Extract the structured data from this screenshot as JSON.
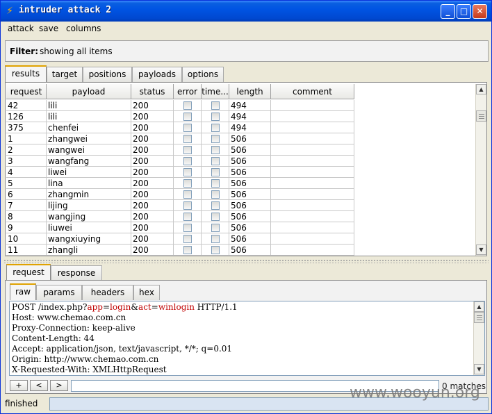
{
  "window": {
    "title": "intruder attack 2",
    "icon": "lightning-icon",
    "controls": {
      "minimize": "_",
      "maximize": "□",
      "close": "✕"
    }
  },
  "menu": [
    "attack",
    "save",
    "columns"
  ],
  "filter": {
    "label": "Filter:",
    "value": "showing all items"
  },
  "main_tabs": [
    "results",
    "target",
    "positions",
    "payloads",
    "options"
  ],
  "main_tab_active": "results",
  "table": {
    "columns": [
      "request",
      "payload",
      "status",
      "error",
      "time...",
      "length",
      "comment"
    ],
    "rows": [
      {
        "request": "42",
        "payload": "lili",
        "status": "200",
        "length": "494"
      },
      {
        "request": "126",
        "payload": "lili",
        "status": "200",
        "length": "494"
      },
      {
        "request": "375",
        "payload": "chenfei",
        "status": "200",
        "length": "494"
      },
      {
        "request": "1",
        "payload": "zhangwei",
        "status": "200",
        "length": "506"
      },
      {
        "request": "2",
        "payload": "wangwei",
        "status": "200",
        "length": "506"
      },
      {
        "request": "3",
        "payload": "wangfang",
        "status": "200",
        "length": "506"
      },
      {
        "request": "4",
        "payload": "liwei",
        "status": "200",
        "length": "506"
      },
      {
        "request": "5",
        "payload": "lina",
        "status": "200",
        "length": "506"
      },
      {
        "request": "6",
        "payload": "zhangmin",
        "status": "200",
        "length": "506"
      },
      {
        "request": "7",
        "payload": "lijing",
        "status": "200",
        "length": "506"
      },
      {
        "request": "8",
        "payload": "wangjing",
        "status": "200",
        "length": "506"
      },
      {
        "request": "9",
        "payload": "liuwei",
        "status": "200",
        "length": "506"
      },
      {
        "request": "10",
        "payload": "wangxiuying",
        "status": "200",
        "length": "506"
      },
      {
        "request": "11",
        "payload": "zhangli",
        "status": "200",
        "length": "506"
      }
    ]
  },
  "detail_tabs": [
    "request",
    "response"
  ],
  "detail_tab_active": "request",
  "view_tabs": [
    "raw",
    "params",
    "headers",
    "hex"
  ],
  "view_tab_active": "raw",
  "request_text": {
    "line1": {
      "pre": "POST /index.php?",
      "k1": "app",
      "eq1": "=",
      "v1": "login",
      "amp": "&",
      "k2": "act",
      "eq2": "=",
      "v2": "winlogin",
      "post": " HTTP/1.1"
    },
    "lines": [
      "Host: www.chemao.com.cn",
      "Proxy-Connection: keep-alive",
      "Content-Length: 44",
      "Accept: application/json, text/javascript, */*; q=0.01",
      "Origin: http://www.chemao.com.cn",
      "X-Requested-With: XMLHttpRequest"
    ]
  },
  "search": {
    "buttons": [
      "+",
      "<",
      ">"
    ],
    "value": "",
    "matches": "0 matches"
  },
  "status": {
    "text": "finished"
  },
  "watermark": "www.wooyun.org"
}
